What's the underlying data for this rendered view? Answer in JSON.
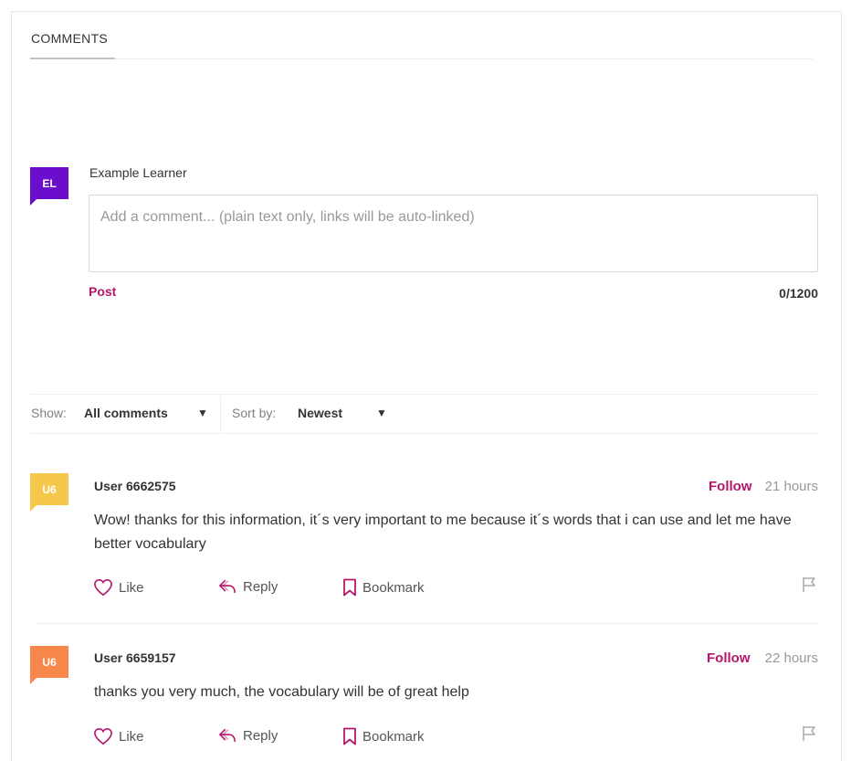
{
  "header": {
    "tab_label": "COMMENTS"
  },
  "composer": {
    "avatar_initials": "EL",
    "avatar_color": "#6a0dcc",
    "user_name": "Example Learner",
    "placeholder": "Add a comment... (plain text only, links will be auto-linked)",
    "value": "",
    "post_label": "Post",
    "char_count": "0/1200"
  },
  "filters": {
    "show_label": "Show:",
    "show_value": "All comments",
    "sort_label": "Sort by:",
    "sort_value": "Newest",
    "caret": "▼"
  },
  "actions": {
    "like": "Like",
    "reply": "Reply",
    "bookmark": "Bookmark",
    "follow": "Follow"
  },
  "comments": [
    {
      "avatar_initials": "U6",
      "avatar_color": "#f5c84c",
      "user": "User 6662575",
      "time": "21 hours",
      "body": "Wow! thanks for this information, it´s very important to me because it´s words that i can use and let me have better vocabulary"
    },
    {
      "avatar_initials": "U6",
      "avatar_color": "#f7874a",
      "user": "User 6659157",
      "time": "22 hours",
      "body": "thanks you very much, the vocabulary will be of great help"
    }
  ],
  "colors": {
    "accent": "#b5166b",
    "icon": "#b5166b"
  },
  "icons": [
    "heart-icon",
    "reply-icon",
    "bookmark-icon",
    "flag-icon",
    "caret-down-icon"
  ]
}
